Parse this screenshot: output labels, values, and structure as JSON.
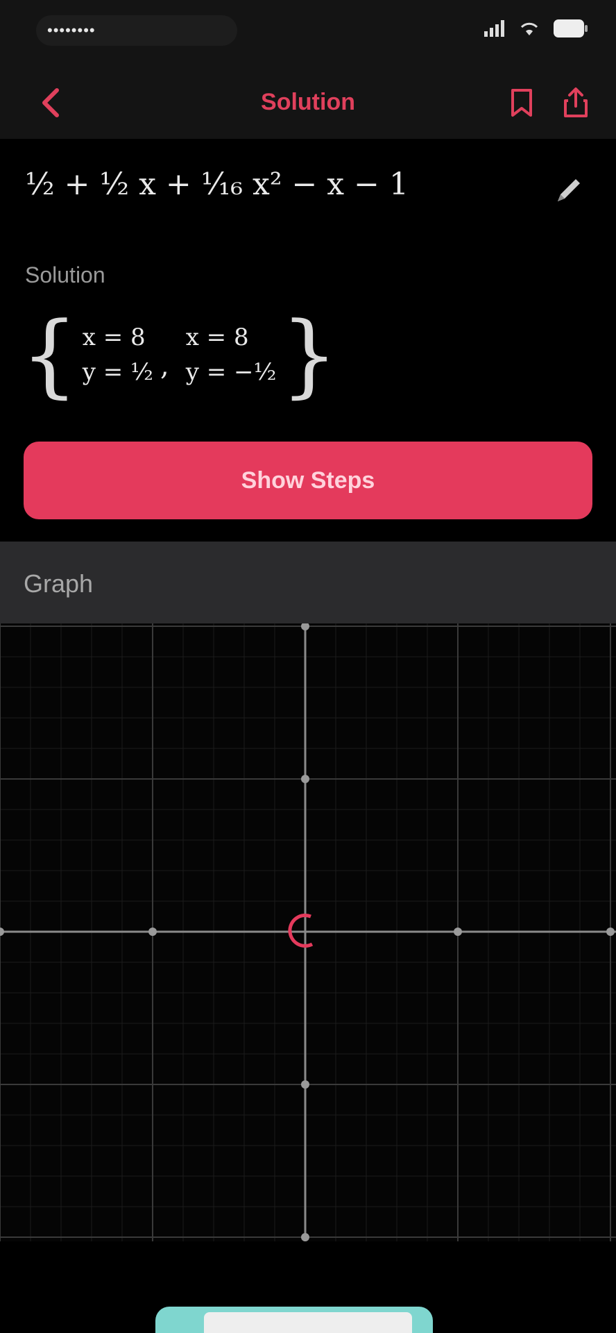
{
  "status_bar": {
    "label": "••••••••",
    "icons": [
      "signal-icon",
      "wifi-icon",
      "battery-icon"
    ]
  },
  "nav": {
    "title": "Solution",
    "back_icon": "chevron-left-icon",
    "actions": [
      "bookmark-icon",
      "share-icon"
    ],
    "accent": "#e43a5c"
  },
  "problem": {
    "equation": "½ + ¹⁄₂ x + ¹⁄₁₆ x² − x − 1",
    "edit_icon": "pencil-icon"
  },
  "solution": {
    "label": "Solution",
    "pairs": [
      {
        "x": "x = 8",
        "y": "y = ½"
      },
      {
        "x": "x = 8",
        "y": "y = −½"
      }
    ],
    "button": "Show Steps"
  },
  "graph": {
    "label": "Graph",
    "origin_marker_color": "#e43a5c"
  },
  "home_indicator": {
    "label": ""
  }
}
